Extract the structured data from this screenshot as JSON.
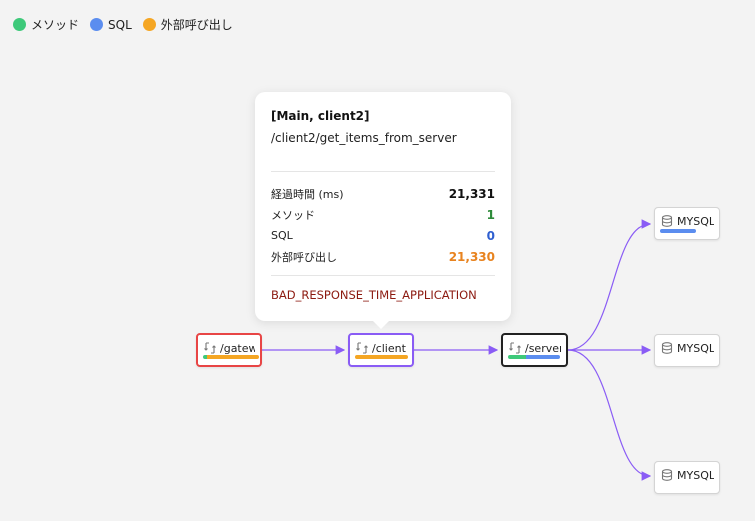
{
  "legend": [
    {
      "label": "メソッド",
      "color": "#3ec97a"
    },
    {
      "label": "SQL",
      "color": "#5b8def"
    },
    {
      "label": "外部呼び出し",
      "color": "#f5a623"
    }
  ],
  "edge_color": "#8a5cf5",
  "nodes": [
    {
      "id": "gateway",
      "label": "/gatew...",
      "icon": "transaction-icon",
      "border_color": "#e84545",
      "bar": [
        {
          "share": 0.07,
          "color": "#3ec97a"
        },
        {
          "share": 0.93,
          "color": "#f5a623"
        }
      ]
    },
    {
      "id": "client",
      "label": "/client...",
      "icon": "transaction-icon",
      "border_color": "#8a5cf5",
      "bar": [
        {
          "share": 1.0,
          "color": "#f5a623"
        }
      ]
    },
    {
      "id": "server",
      "label": "/server...",
      "icon": "transaction-icon",
      "border_color": "#222222",
      "bar": [
        {
          "share": 0.35,
          "color": "#3ec97a"
        },
        {
          "share": 0.65,
          "color": "#5b8def"
        }
      ]
    },
    {
      "id": "mysql-1",
      "label": "MYSQL",
      "icon": "database-icon",
      "border_color": "#d4d4d4",
      "bar": [
        {
          "share": 1.0,
          "color": "#5b8def"
        }
      ]
    },
    {
      "id": "mysql-2",
      "label": "MYSQL",
      "icon": "database-icon",
      "border_color": "#d4d4d4",
      "bar": []
    },
    {
      "id": "mysql-3",
      "label": "MYSQL",
      "icon": "database-icon",
      "border_color": "#d4d4d4",
      "bar": []
    }
  ],
  "tooltip": {
    "title": "[Main, client2]",
    "path": "/client2/get_items_from_server",
    "rows": [
      {
        "label": "経過時間 (ms)",
        "value": "21,331",
        "color": "#111111"
      },
      {
        "label": "メソッド",
        "value": "1",
        "color": "#2e8b3a"
      },
      {
        "label": "SQL",
        "value": "0",
        "color": "#2f5fd0"
      },
      {
        "label": "外部呼び出し",
        "value": "21,330",
        "color": "#e8831f"
      }
    ],
    "error": "BAD_RESPONSE_TIME_APPLICATION"
  }
}
